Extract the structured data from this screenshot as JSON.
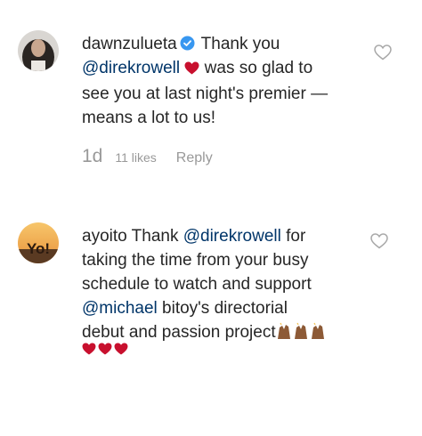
{
  "comments": [
    {
      "username": "dawnzulueta",
      "verified": true,
      "lines": {
        "l1_text": "Thank you",
        "l2_mention": "@direkrowell",
        "l2_text": "was so glad to",
        "l3": "see you at last night's premier —",
        "l4": "means a lot to us!"
      },
      "meta": {
        "time": "1d",
        "likes": "11 likes",
        "reply": "Reply"
      }
    },
    {
      "username": "ayoito",
      "avatar_text": "Yo!",
      "lines": {
        "l1_text": "Thank",
        "l1_mention": "@direkrowell",
        "l1_text2": "for",
        "l2": "taking the time from your busy",
        "l3": "schedule to watch and support",
        "l4_mention": "@michael",
        "l4_text": "bitoy's directorial",
        "l5": "debut and passion project"
      }
    }
  ],
  "icons": {
    "like": "heart-outline-icon",
    "verified": "verified-badge-icon",
    "red_heart": "red-heart-emoji",
    "clap": "clapping-hands-emoji"
  },
  "colors": {
    "text": "#262626",
    "mention": "#003569",
    "meta": "#999999",
    "verified_blue": "#3897f0",
    "heart_red": "#c8102e"
  }
}
